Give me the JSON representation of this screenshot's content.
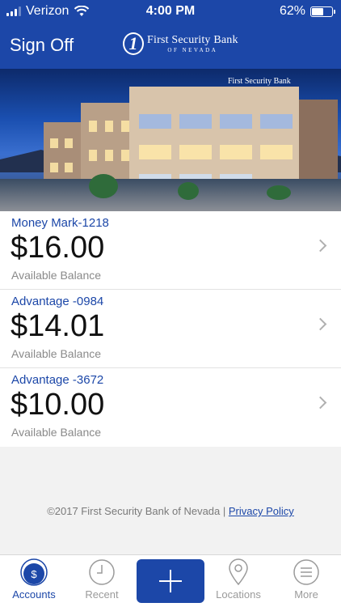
{
  "status_bar": {
    "carrier": "Verizon",
    "time": "4:00 PM",
    "battery_percent": "62%",
    "battery_level": 0.62
  },
  "header": {
    "sign_off_label": "Sign Off",
    "logo_line1": "First Security Bank",
    "logo_line2": "OF NEVADA",
    "logo_mark": "1"
  },
  "hero": {
    "building_sign": "First Security Bank"
  },
  "accounts": [
    {
      "name": "Money Mark-1218",
      "balance": "$16.00",
      "balance_label": "Available Balance"
    },
    {
      "name": "Advantage -0984",
      "balance": "$14.01",
      "balance_label": "Available Balance"
    },
    {
      "name": "Advantage -3672",
      "balance": "$10.00",
      "balance_label": "Available Balance"
    }
  ],
  "footer": {
    "copyright": "©2017 First Security Bank of Nevada |",
    "privacy_link": "Privacy Policy"
  },
  "tabbar": {
    "items": [
      {
        "label": "Accounts",
        "icon": "dollar-circle-icon",
        "active": true
      },
      {
        "label": "Recent",
        "icon": "clock-icon",
        "active": false
      },
      {
        "label": "",
        "icon": "plus-icon",
        "active": false
      },
      {
        "label": "Locations",
        "icon": "map-pin-icon",
        "active": false
      },
      {
        "label": "More",
        "icon": "menu-icon",
        "active": false
      }
    ]
  },
  "colors": {
    "brand_blue": "#1c47a8",
    "muted_text": "#8a8a8a",
    "chevron": "#b0b0b0"
  }
}
